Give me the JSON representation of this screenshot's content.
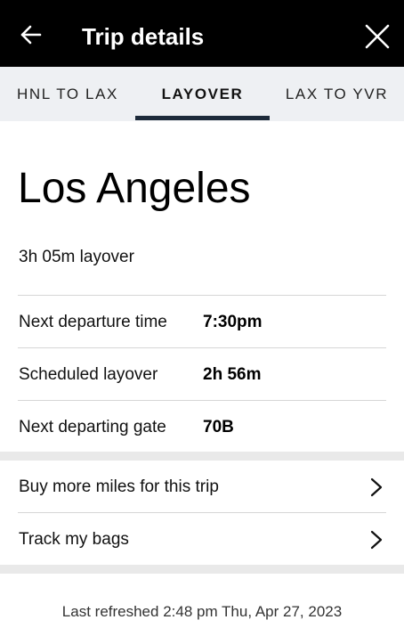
{
  "header": {
    "title": "Trip details",
    "back_icon": "arrow-left-icon",
    "close_icon": "close-icon",
    "background": "#000000"
  },
  "tabs": [
    {
      "label": "HNL TO LAX",
      "active": false
    },
    {
      "label": "LAYOVER",
      "active": true
    },
    {
      "label": "LAX TO YVR",
      "active": false
    }
  ],
  "layover": {
    "city": "Los Angeles",
    "duration": "3h 05m layover",
    "details": [
      {
        "label": "Next departure time",
        "value": "7:30pm"
      },
      {
        "label": "Scheduled layover",
        "value": "2h 56m"
      },
      {
        "label": "Next departing gate",
        "value": "70B"
      }
    ]
  },
  "links": [
    {
      "label": "Buy more miles for this trip",
      "icon": "chevron-right-icon"
    },
    {
      "label": "Track my bags",
      "icon": "chevron-right-icon"
    }
  ],
  "footer": {
    "last_refreshed": "Last refreshed 2:48 pm Thu, Apr 27, 2023"
  },
  "colors": {
    "tab_bar_background": "#eef0f3",
    "active_tab_indicator": "#1d2a3a",
    "section_band": "#e9e9e9"
  }
}
